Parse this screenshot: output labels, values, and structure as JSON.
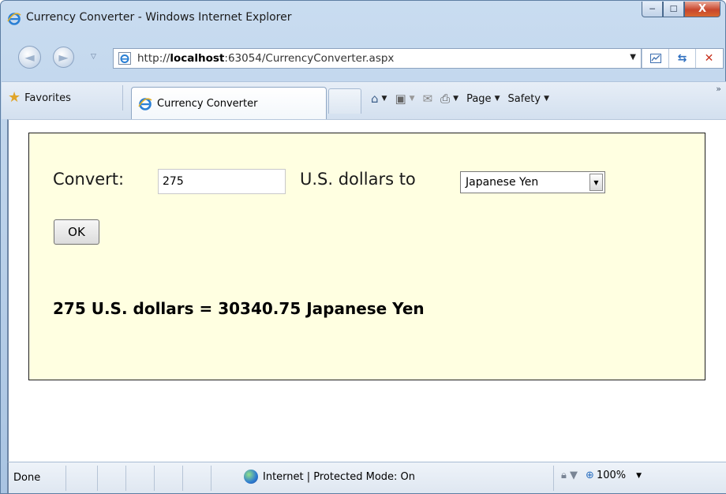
{
  "window": {
    "title": "Currency Converter - Windows Internet Explorer",
    "controls": {
      "minimize": "─",
      "maximize": "☐",
      "close": "X"
    }
  },
  "address_bar": {
    "url_prefix": "http://",
    "url_host": "localhost",
    "url_rest": ":63054/CurrencyConverter.aspx"
  },
  "favorites_bar": {
    "favorites_label": "Favorites",
    "tab_title": "Currency Converter"
  },
  "command_bar": {
    "page_label": "Page",
    "safety_label": "Safety",
    "overflow": "»"
  },
  "form": {
    "convert_label": "Convert:",
    "amount_value": "275",
    "to_label": "U.S. dollars to",
    "currency_selected": "Japanese Yen",
    "ok_label": "OK",
    "result_text": "275 U.S. dollars = 30340.75 Japanese Yen"
  },
  "status_bar": {
    "status": "Done",
    "zone": "Internet | Protected Mode: On",
    "zoom": "100%"
  },
  "icons": [
    "ie-logo-icon",
    "back-icon",
    "forward-icon",
    "compatibility-icon",
    "refresh-icon",
    "stop-icon",
    "star-icon",
    "home-icon",
    "feeds-icon",
    "mail-icon",
    "print-icon",
    "globe-icon",
    "security-icon",
    "zoom-icon"
  ],
  "colors": {
    "panel_background": "#ffffe1",
    "window_frame": "#a9c4e2"
  }
}
